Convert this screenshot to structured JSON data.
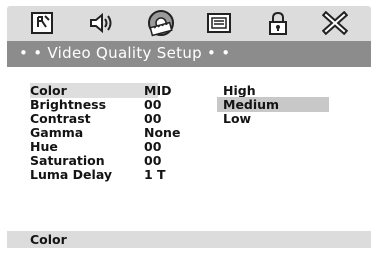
{
  "toolbar": {
    "icons": [
      "language-setup-icon",
      "audio-setup-icon",
      "video-setup-icon",
      "preferences-icon",
      "password-icon",
      "exit-icon"
    ]
  },
  "title": "• • Video Quality Setup • •",
  "settings": [
    {
      "label": "Color",
      "value": "MID"
    },
    {
      "label": "Brightness",
      "value": "00"
    },
    {
      "label": "Contrast",
      "value": "00"
    },
    {
      "label": "Gamma",
      "value": "None"
    },
    {
      "label": "Hue",
      "value": "00"
    },
    {
      "label": "Saturation",
      "value": "00"
    },
    {
      "label": "Luma Delay",
      "value": "1 T"
    }
  ],
  "options": [
    "High",
    "Medium",
    "Low"
  ],
  "selected_option": "Medium",
  "status": "Color"
}
